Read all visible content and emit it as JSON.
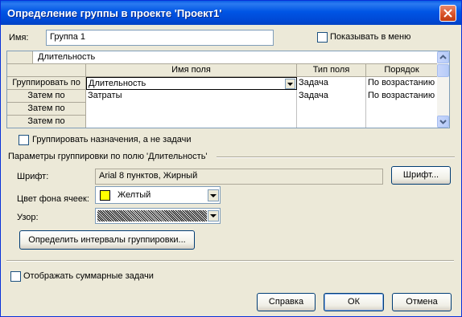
{
  "window": {
    "title": "Определение группы в проекте 'Проект1'"
  },
  "name": {
    "label": "Имя:",
    "value": "Группа 1"
  },
  "show_in_menu": {
    "label": "Показывать в меню",
    "checked": false
  },
  "grid": {
    "edit_value": "Длительность",
    "columns": [
      "Имя поля",
      "Тип поля",
      "Порядок"
    ],
    "rows": [
      {
        "header": "Группировать по",
        "field": "Длительность",
        "type": "Задача",
        "order": "По возрастанию"
      },
      {
        "header": "Затем по",
        "field": "Затраты",
        "type": "Задача",
        "order": "По возрастанию"
      },
      {
        "header": "Затем по",
        "field": "",
        "type": "",
        "order": ""
      },
      {
        "header": "Затем по",
        "field": "",
        "type": "",
        "order": ""
      }
    ]
  },
  "group_assignments": {
    "label": "Группировать назначения, а не задачи",
    "checked": false
  },
  "params": {
    "title": "Параметры группировки по полю 'Длительность'",
    "font_label": "Шрифт:",
    "font_value": "Arial 8 пунктов, Жирный",
    "font_button": "Шрифт...",
    "cell_bg_label": "Цвет фона ячеек:",
    "cell_bg_value": "Желтый",
    "cell_bg_color": "#ffff00",
    "pattern_label": "Узор:",
    "intervals_button": "Определить интервалы группировки..."
  },
  "show_summary": {
    "label": "Отображать суммарные задачи",
    "checked": false
  },
  "buttons": {
    "help": "Справка",
    "ok": "ОК",
    "cancel": "Отмена"
  }
}
